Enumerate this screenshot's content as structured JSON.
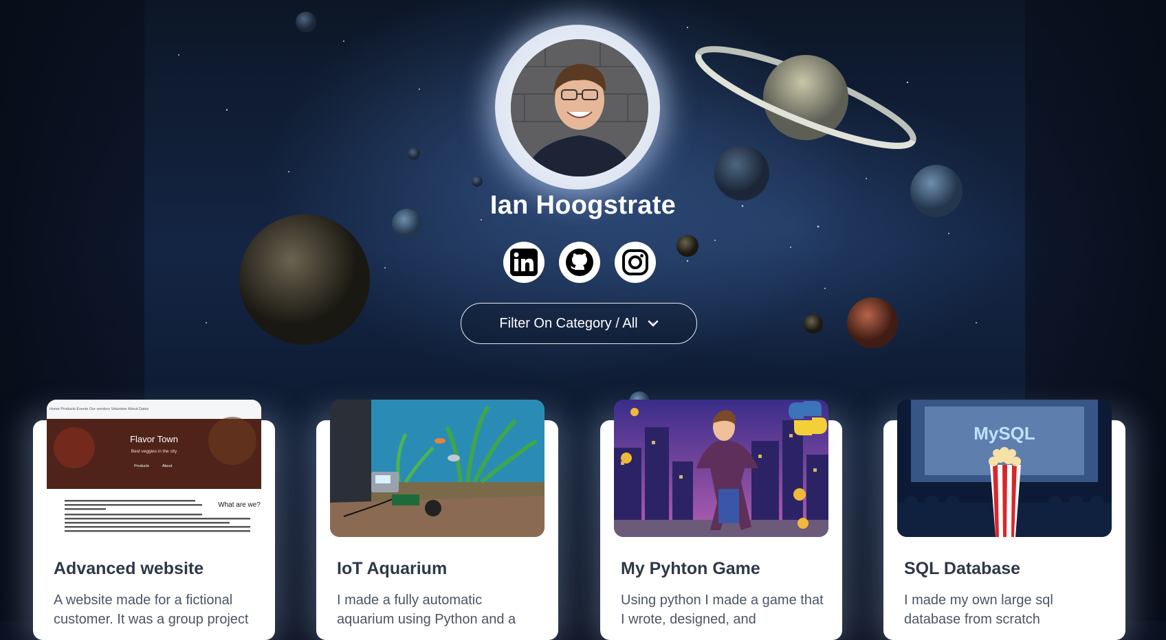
{
  "profile": {
    "name": "Ian Hoogstrate",
    "photo": "profile-photo"
  },
  "socials": [
    {
      "name": "LinkedIn",
      "icon": "linkedin-icon"
    },
    {
      "name": "GitHub",
      "icon": "github-icon"
    },
    {
      "name": "Instagram",
      "icon": "instagram-icon"
    }
  ],
  "filter": {
    "label": "Filter On Category / All",
    "icon": "chevron-down-icon"
  },
  "projects": [
    {
      "title": "Advanced website",
      "description": "A website made for a fictional customer. It was a group project",
      "image": "website-screenshot",
      "screenshot": {
        "nav": "Home   Products   Events   Our vendors   Volunteer   About   Dates",
        "hero_title": "Flavor Town",
        "hero_sub": "Best veggies in the city",
        "btn1": "Products",
        "btn2": "About",
        "section_title": "What are we?"
      }
    },
    {
      "title": "IoT Aquarium",
      "description": "I made a fully automatic aquarium using Python and a",
      "image": "aquarium-photo"
    },
    {
      "title": "My Pyhton Game",
      "description": "Using python I made a game that I wrote, designed, and",
      "image": "game-art"
    },
    {
      "title": "SQL Database",
      "description": "I made my own large sql database from scratch",
      "image": "mysql-cinema-art",
      "logo_text": "MySQL"
    }
  ],
  "colors": {
    "background": "#0a1020",
    "card": "#ffffff",
    "title_text": "#2f3847",
    "desc_text": "#4b5563",
    "hero_text": "#ffffff"
  }
}
